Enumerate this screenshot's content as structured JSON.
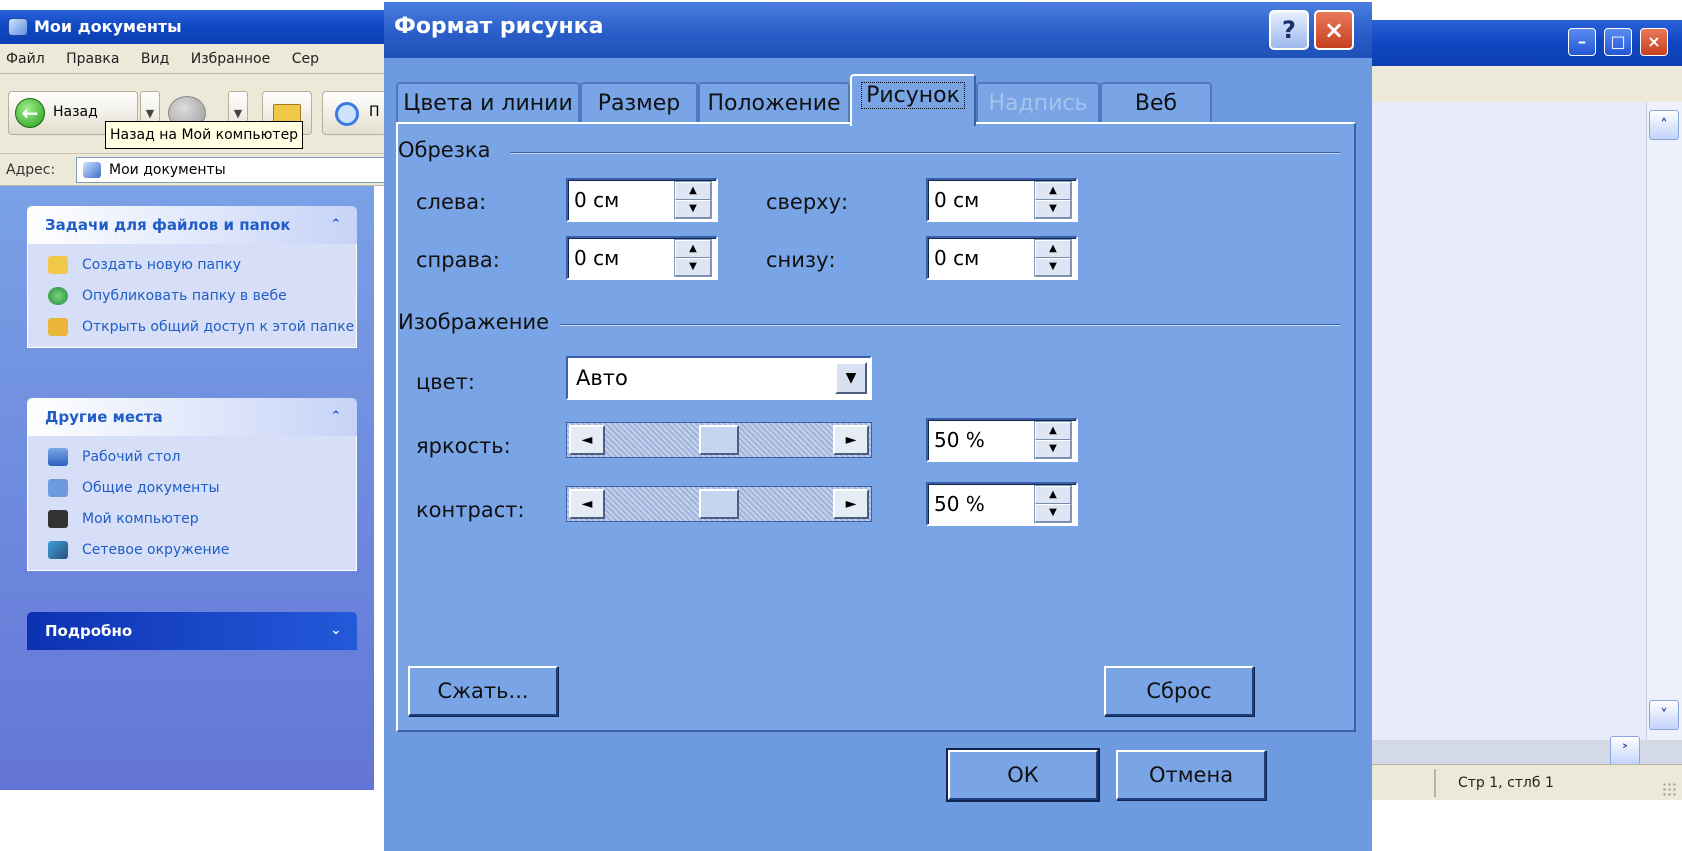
{
  "explorer": {
    "title": "Мои документы",
    "menu": [
      "Файл",
      "Правка",
      "Вид",
      "Избранное",
      "Сер"
    ],
    "toolbar": {
      "back_label": "Назад",
      "search_label": "П"
    },
    "tooltip": "Назад на Мой компьютер",
    "address": {
      "label": "Адрес:",
      "value": "Мои документы"
    },
    "panels": {
      "tasks": {
        "title": "Задачи для файлов и папок",
        "items": [
          "Создать новую папку",
          "Опубликовать папку в вебе",
          "Открыть общий доступ к этой папке"
        ]
      },
      "places": {
        "title": "Другие места",
        "items": [
          "Рабочий стол",
          "Общие документы",
          "Мой компьютер",
          "Сетевое окружение"
        ]
      },
      "details": {
        "title": "Подробно"
      }
    }
  },
  "dialog": {
    "title": "Формат рисунка",
    "help_glyph": "?",
    "close_glyph": "×",
    "tabs": [
      "Цвета и линии",
      "Размер",
      "Положение",
      "Рисунок",
      "Надпись",
      "Веб"
    ],
    "active_tab": "Рисунок",
    "crop": {
      "group_label": "Обрезка",
      "left_label": "слева:",
      "left_value": "0 см",
      "right_label": "справа:",
      "right_value": "0 см",
      "top_label": "сверху:",
      "top_value": "0 см",
      "bottom_label": "снизу:",
      "bottom_value": "0 см"
    },
    "image": {
      "group_label": "Изображение",
      "color_label": "цвет:",
      "color_value": "Авто",
      "brightness_label": "яркость:",
      "brightness_value": "50 %",
      "brightness_level": 0.5,
      "contrast_label": "контраст:",
      "contrast_value": "50 %",
      "contrast_level": 0.5
    },
    "compress_label": "Сжать...",
    "reset_label": "Сброс",
    "ok_label": "ОК",
    "cancel_label": "Отмена"
  },
  "word": {
    "status": "Стр 1, стлб 1"
  }
}
